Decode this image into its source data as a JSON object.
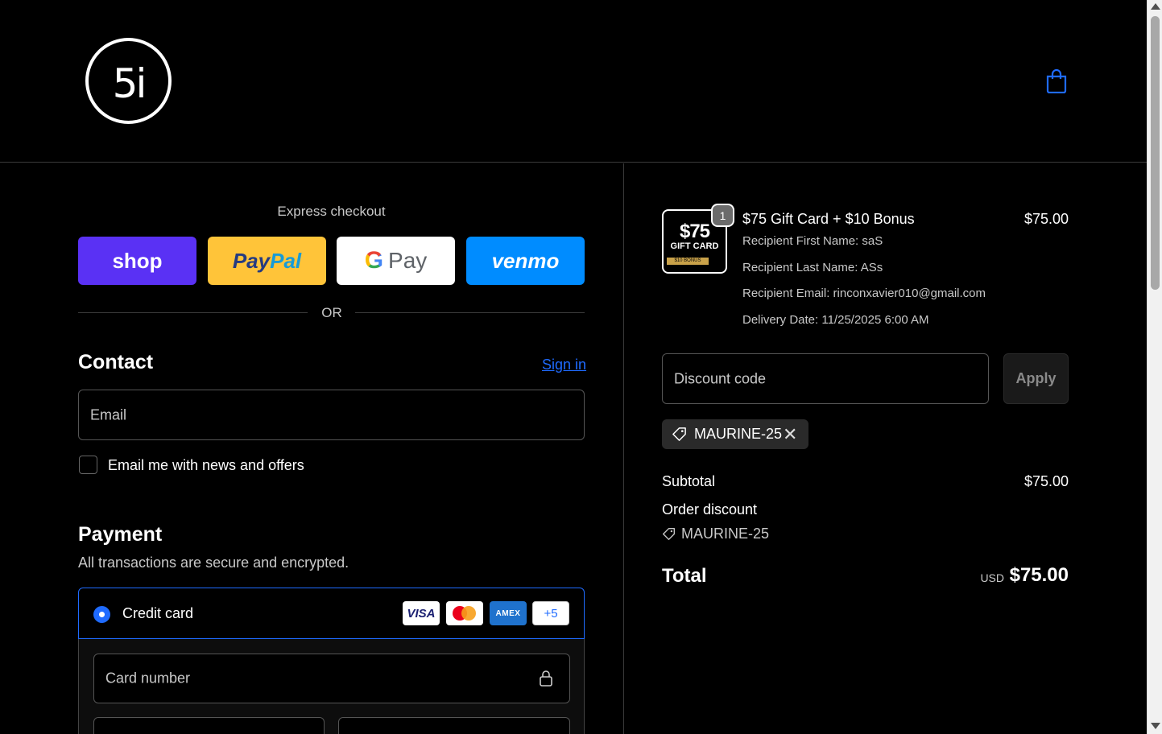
{
  "brand": {
    "logo_text": "5i"
  },
  "express": {
    "title": "Express checkout",
    "buttons": {
      "shop": "shop",
      "paypal_1": "Pay",
      "paypal_2": "Pal",
      "gpay_g": "G",
      "gpay": "Pay",
      "venmo": "venmo"
    },
    "or": "OR"
  },
  "contact": {
    "title": "Contact",
    "sign_in": "Sign in",
    "email_placeholder": "Email",
    "news_label": "Email me with news and offers"
  },
  "payment": {
    "title": "Payment",
    "subtitle": "All transactions are secure and encrypted.",
    "method_label": "Credit card",
    "cards": {
      "visa": "VISA",
      "amex": "AMEX",
      "more": "+5"
    },
    "card_number_placeholder": "Card number"
  },
  "order": {
    "thumb": {
      "price": "$75",
      "label": "GIFT CARD",
      "bonus": "$10 BONUS"
    },
    "quantity": "1",
    "item_title": "$75 Gift Card + $10 Bonus",
    "item_price": "$75.00",
    "meta": [
      "Recipient First Name: saS",
      "Recipient Last Name: ASs",
      "Recipient Email: rinconxavier010@gmail.com",
      "Delivery Date: 11/25/2025 6:00 AM"
    ],
    "discount_placeholder": "Discount code",
    "apply": "Apply",
    "applied_code": "MAURINE-25",
    "subtotal_label": "Subtotal",
    "subtotal_value": "$75.00",
    "order_discount_label": "Order discount",
    "order_discount_code": "MAURINE-25",
    "total_label": "Total",
    "currency": "USD",
    "total_value": "$75.00"
  },
  "colors": {
    "background": "#000000",
    "accent": "#1f6bff",
    "shop": "#5a31f4",
    "paypal": "#ffc439",
    "venmo": "#008cff"
  }
}
